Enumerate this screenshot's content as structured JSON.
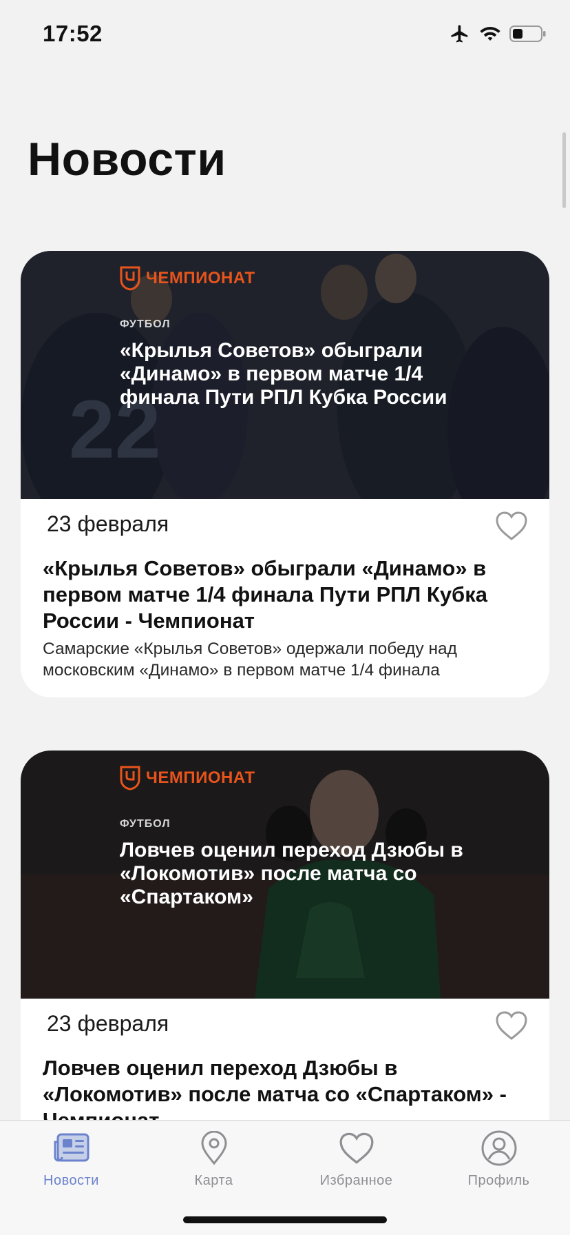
{
  "status_bar": {
    "time": "17:52",
    "icons": [
      "airplane-icon",
      "wifi-icon",
      "battery-icon"
    ]
  },
  "page": {
    "title": "Новости"
  },
  "news": [
    {
      "brand": "ЧЕМПИОНАТ",
      "category": "ФУТБОЛ",
      "image_headline": "«Крылья Советов» обыграли «Динамо» в первом матче 1/4 финала Пути РПЛ Кубка России",
      "date": "23 февраля",
      "title": "«Крылья Советов» обыграли «Динамо» в первом матче 1/4 финала Пути РПЛ Кубка России - Чемпионат",
      "description": "Самарские «Крылья Советов» одержали победу над московским «Динамо» в первом матче 1/4 финала",
      "liked": false
    },
    {
      "brand": "ЧЕМПИОНАТ",
      "category": "ФУТБОЛ",
      "image_headline": "Ловчев оценил переход Дзюбы в «Локомотив» после матча со «Спартаком»",
      "date": "23 февраля",
      "title": "Ловчев оценил переход Дзюбы в «Локомотив» после матча со «Спартаком» - Чемпионат",
      "description": "",
      "liked": false
    }
  ],
  "tab_bar": {
    "tabs": [
      {
        "label": "Новости",
        "icon": "newspaper-icon",
        "active": true
      },
      {
        "label": "Карта",
        "icon": "map-pin-icon",
        "active": false
      },
      {
        "label": "Избранное",
        "icon": "heart-icon",
        "active": false
      },
      {
        "label": "Профиль",
        "icon": "profile-icon",
        "active": false
      }
    ]
  },
  "colors": {
    "accent": "#6b83cc",
    "brand": "#e8541b",
    "inactive": "#8e8e93",
    "background": "#f2f2f2"
  }
}
